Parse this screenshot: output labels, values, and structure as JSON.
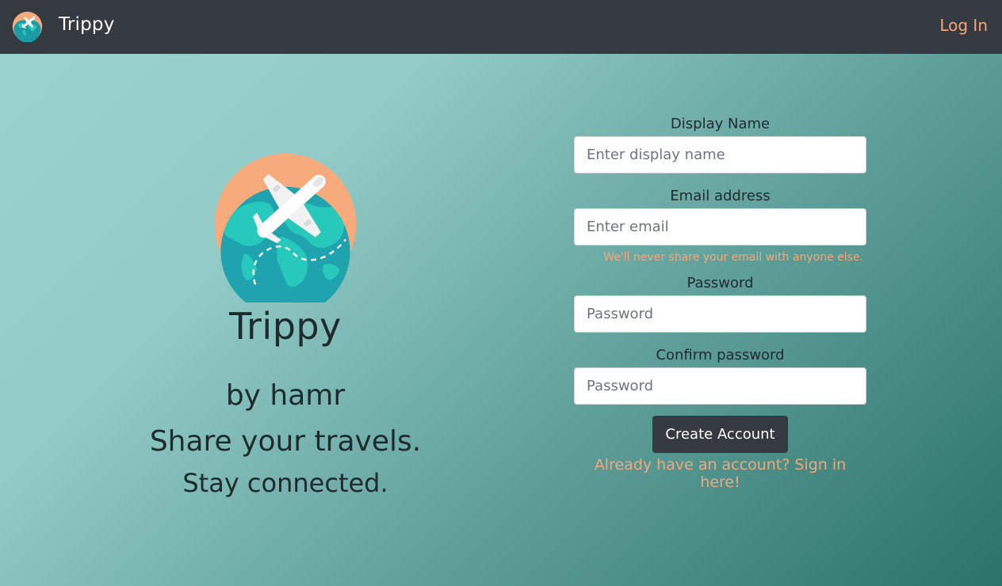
{
  "nav": {
    "brand": "Trippy",
    "login_label": "Log In",
    "logo_icon": "airplane-globe-icon"
  },
  "hero": {
    "title": "Trippy",
    "byline": "by hamr",
    "tagline_1": "Share your travels.",
    "tagline_2": "Stay connected."
  },
  "form": {
    "display_name": {
      "label": "Display Name",
      "placeholder": "Enter display name",
      "value": ""
    },
    "email": {
      "label": "Email address",
      "placeholder": "Enter email",
      "value": "",
      "help": "We'll never share your email with anyone else."
    },
    "password": {
      "label": "Password",
      "placeholder": "Password",
      "value": ""
    },
    "confirm_password": {
      "label": "Confirm password",
      "placeholder": "Password",
      "value": ""
    },
    "submit_label": "Create Account",
    "signin_text": "Already have an account? Sign in here!"
  },
  "colors": {
    "navbar": "#343a40",
    "accent": "#f4a77d",
    "teal_light": "#9ad2cf",
    "teal_dark": "#2b7269",
    "globe": "#1fa9b4",
    "land": "#28c9bd"
  }
}
